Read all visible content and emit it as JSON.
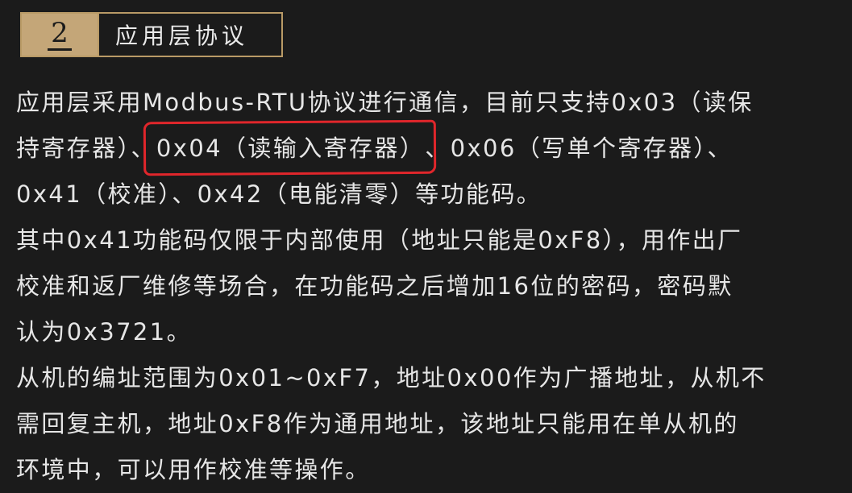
{
  "header": {
    "number": "2",
    "title": "应用层协议"
  },
  "lines": {
    "l1": "应用层采用Modbus-RTU协议进行通信，目前只支持0x03（读保",
    "l2a": "持寄存器）、",
    "l2b": "0x04（读输入寄存器）",
    "l2c": "、0x06（写单个寄存器）、",
    "l3": "0x41（校准）、0x42（电能清零）等功能码。",
    "l4": "其中0x41功能码仅限于内部使用（地址只能是0xF8），用作出厂",
    "l5": "校准和返厂维修等场合，在功能码之后增加16位的密码，密码默",
    "l6": "认为0x3721。",
    "l7": "从机的编址范围为0x01~0xF7，地址0x00作为广播地址，从机不",
    "l8": "需回复主机，地址0xF8作为通用地址，该地址只能用在单从机的",
    "l9": "环境中，可以用作校准等操作。"
  },
  "colors": {
    "background": "#1b1b1b",
    "accent_gold": "#c4a678",
    "highlight_red": "#e0262b",
    "text": "#e6e6e6"
  }
}
